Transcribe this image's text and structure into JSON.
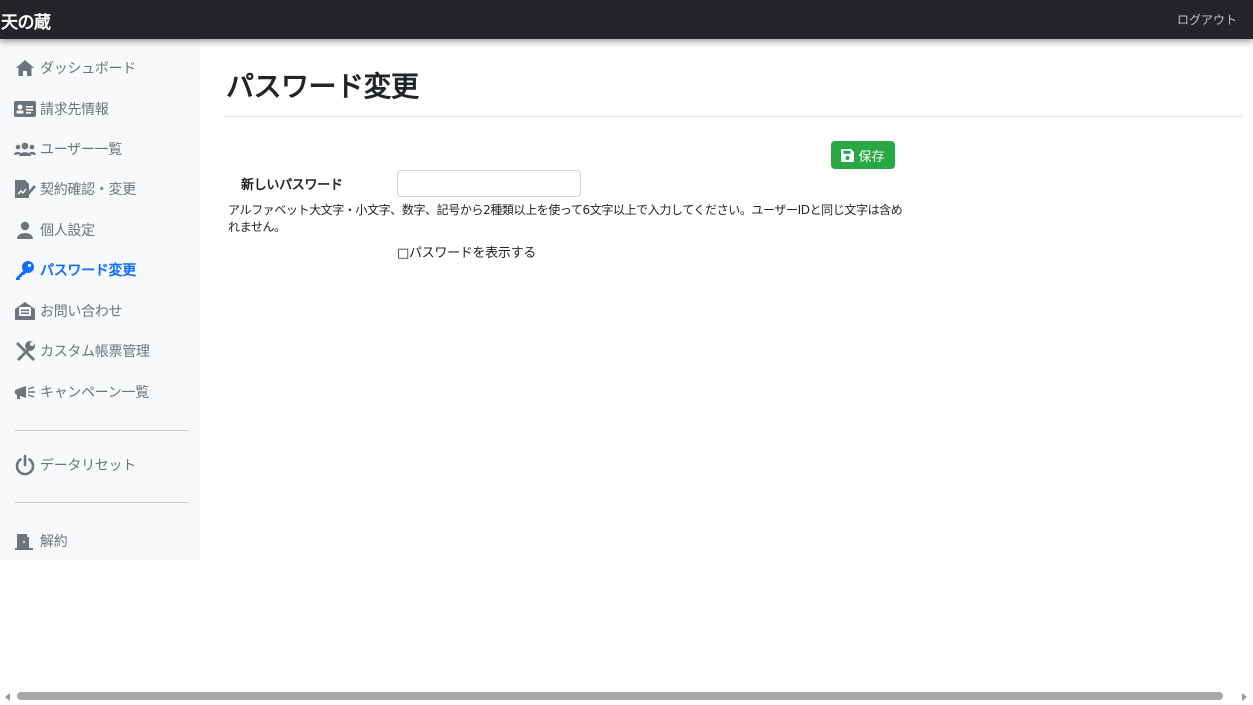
{
  "app": {
    "brand": "天の蔵",
    "logout": "ログアウト"
  },
  "sidebar": {
    "items": [
      {
        "label": "ダッシュボード",
        "icon": "home-icon"
      },
      {
        "label": "請求先情報",
        "icon": "id-card-icon"
      },
      {
        "label": "ユーザー一覧",
        "icon": "users-icon"
      },
      {
        "label": "契約確認・変更",
        "icon": "file-signature-icon"
      },
      {
        "label": "個人設定",
        "icon": "user-icon"
      },
      {
        "label": "パスワード変更",
        "icon": "key-icon",
        "active": true
      },
      {
        "label": "お問い合わせ",
        "icon": "envelope-open-icon"
      },
      {
        "label": "カスタム帳票管理",
        "icon": "tools-icon"
      },
      {
        "label": "キャンペーン一覧",
        "icon": "megaphone-icon"
      },
      {
        "label": "データリセット",
        "icon": "power-icon"
      },
      {
        "label": "解約",
        "icon": "door-exit-icon"
      }
    ]
  },
  "main": {
    "title": "パスワード変更",
    "save_label": "保存",
    "form": {
      "password_label": "新しいパスワード",
      "password_value": "",
      "help": "アルファベット大文字・小文字、数字、記号から2種類以上を使って6文字以上で入力してください。ユーザーIDと同じ文字は含めれません。",
      "show_password_label": "□パスワードを表示する"
    }
  },
  "colors": {
    "topbar": "#222428",
    "sidebar_bg": "#f8f9fa",
    "active": "#0d6efd",
    "save_button": "#28a745",
    "nav_text": "#6c757d"
  }
}
